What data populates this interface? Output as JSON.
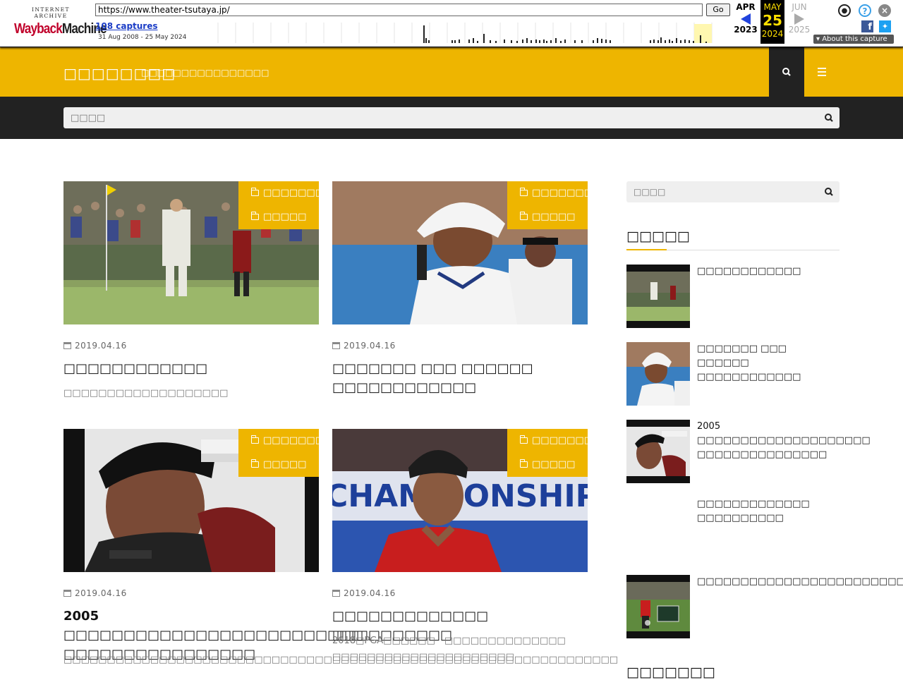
{
  "wayback": {
    "logo_top": "INTERNET ARCHIVE",
    "logo_main": "Wayback",
    "logo_main2": "Machine",
    "url": "https://www.theater-tsutaya.jp/",
    "go_label": "Go",
    "captures": "108 captures",
    "range": "31 Aug 2008 - 25 May 2024",
    "prev_month": "APR",
    "prev_year": "2023",
    "cur_month": "MAY",
    "cur_day": "25",
    "cur_year": "2024",
    "next_month": "JUN",
    "next_year": "2025",
    "about": "About this capture",
    "user_icon": "user-icon",
    "help_icon": "help-icon",
    "close_icon": "close-icon"
  },
  "header": {
    "site_title": "□□□□□□□□",
    "site_desc": "□□□□□□□□□□□□□□□□",
    "accent": "#eeb500",
    "dark": "#222222"
  },
  "search_band": {
    "placeholder": "□□□□"
  },
  "cards": [
    {
      "categories": [
        "□□□□□□□",
        "□□□□□"
      ],
      "date": "2019.04.16",
      "title": "□□□□□□□□□□□□",
      "excerpt": "□□□□□□□□□□□□□□□□□□□"
    },
    {
      "categories": [
        "□□□□□□□",
        "□□□□□"
      ],
      "date": "2019.04.16",
      "title": "□□□□□□□ □□□ □□□□□□ □□□□□□□□□□□□",
      "excerpt": ""
    },
    {
      "categories": [
        "□□□□□□□",
        "□□□□□"
      ],
      "date": "2019.04.16",
      "title": "2005 □□□□□□□□□□□□□□□□□□□□□□□□□　□□□□□□□□□□□□□□□□",
      "excerpt": "□□□□□□□□□□□□□□□□□□□□□□□□□□□□□□□□□□□□□□□□□□□□□□□□□□□□□□□□□□□□□□□□"
    },
    {
      "categories": [
        "□□□□□□□",
        "□□□□□"
      ],
      "date": "2019.04.16",
      "title": "□□□□□□□□□□□□□ □□□□□□□□□□",
      "excerpt": "2018□PGA□□□□□□　□□□□□□□□□□□□□□ □□□□□□□□□□□□□□□□□□□□□"
    }
  ],
  "sidebar": {
    "search_placeholder": "□□□□",
    "heading": "□□□□□",
    "items": [
      {
        "title": "□□□□□□□□□□□□"
      },
      {
        "title": "□□□□□□□ □□□ □□□□□□ □□□□□□□□□□□□"
      },
      {
        "title": "2005 □□□□□□□□□□□□□□□□□□□□　□□□□□□□□□□□□□□□"
      },
      {
        "title": "□□□□□□□□□□□□□ □□□□□□□□□□"
      },
      {
        "title": "□□□□□□□□□□□□□□□□□□□□□□□□□□□□"
      }
    ],
    "heading2": "□□□□□□□"
  }
}
